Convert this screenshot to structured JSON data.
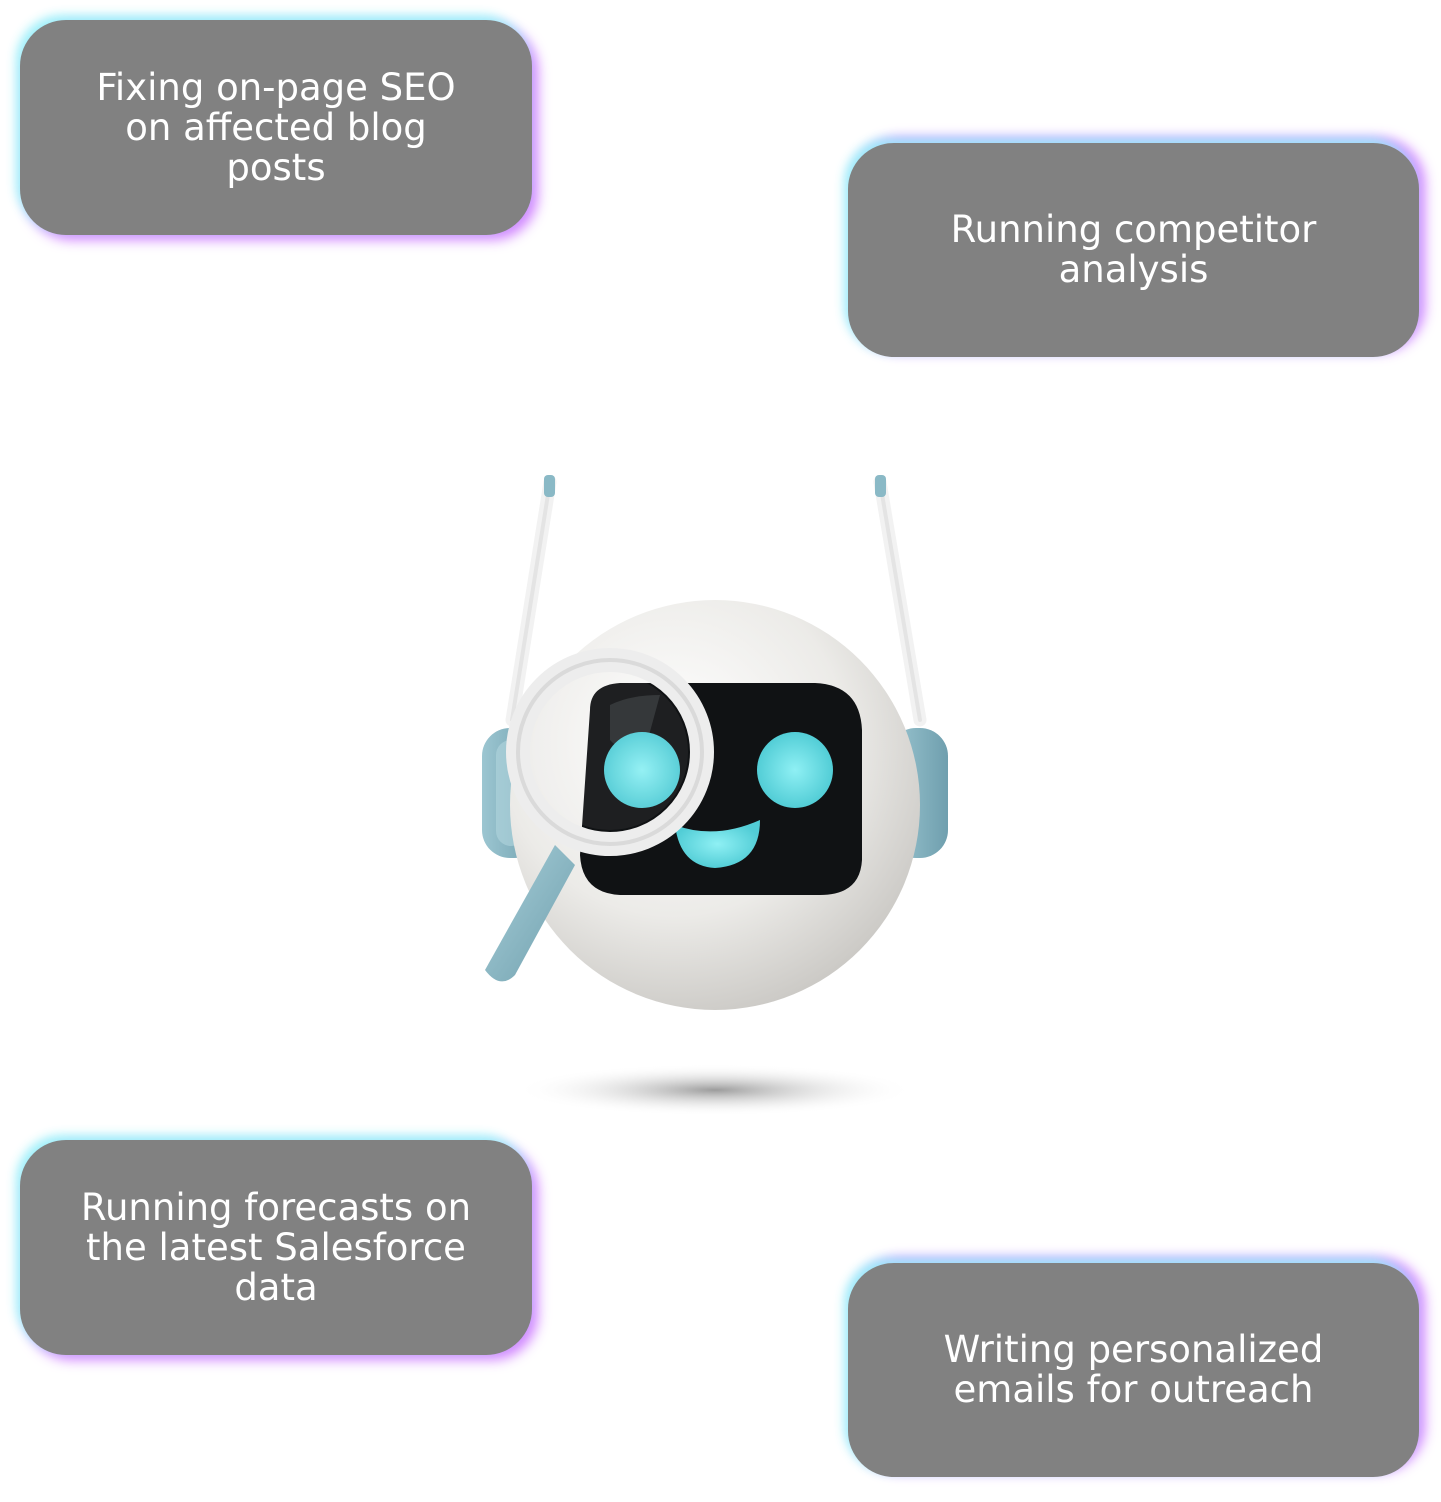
{
  "cards": [
    {
      "text": "Fixing on-page SEO\non affected blog\nposts"
    },
    {
      "text": "Running competitor\nanalysis"
    },
    {
      "text": "Running forecasts on\nthe latest Salesforce\ndata"
    },
    {
      "text": "Writing personalized\nemails for outreach"
    }
  ],
  "colors": {
    "card_bg": "#818181",
    "card_text": "#ffffff",
    "glow_cyan": "#96f0fa",
    "glow_purple": "#cd78ff",
    "robot_eye": "#6fdde3",
    "robot_accent": "#8ab9c6"
  },
  "robot": {
    "icon": "robot-magnifier-mascot-icon"
  }
}
